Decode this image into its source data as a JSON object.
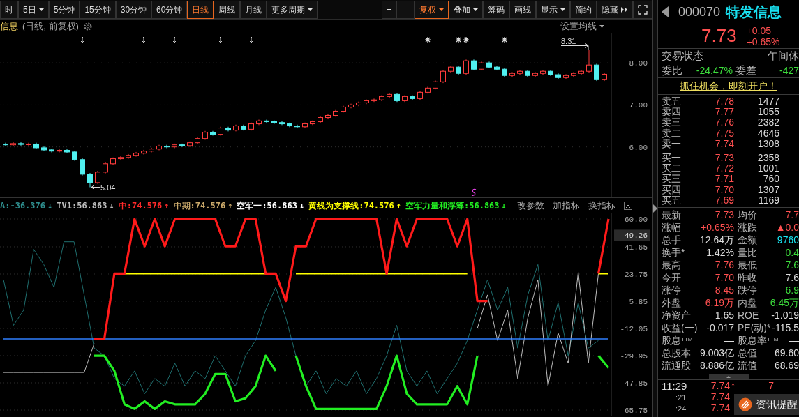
{
  "toolbar": {
    "periods": [
      {
        "label": "时",
        "selected": false,
        "dropdown": false
      },
      {
        "label": "5日",
        "selected": false,
        "dropdown": true
      },
      {
        "label": "5分钟",
        "selected": false,
        "dropdown": false
      },
      {
        "label": "15分钟",
        "selected": false,
        "dropdown": false
      },
      {
        "label": "30分钟",
        "selected": false,
        "dropdown": false
      },
      {
        "label": "60分钟",
        "selected": false,
        "dropdown": false
      },
      {
        "label": "日线",
        "selected": true,
        "dropdown": false
      },
      {
        "label": "周线",
        "selected": false,
        "dropdown": false
      },
      {
        "label": "月线",
        "selected": false,
        "dropdown": false
      },
      {
        "label": "更多周期",
        "selected": false,
        "dropdown": true
      }
    ],
    "tools": [
      {
        "label": "+",
        "selected": false,
        "dropdown": false
      },
      {
        "label": "—",
        "selected": false,
        "dropdown": false
      },
      {
        "label": "复权",
        "selected": true,
        "dropdown": true
      },
      {
        "label": "叠加",
        "selected": false,
        "dropdown": true
      },
      {
        "label": "筹码",
        "selected": false,
        "dropdown": false
      },
      {
        "label": "画线",
        "selected": false,
        "dropdown": false
      },
      {
        "label": "显示",
        "selected": false,
        "dropdown": true
      },
      {
        "label": "简约",
        "selected": false,
        "dropdown": false
      },
      {
        "label": "隐藏",
        "selected": false,
        "dropdown": false,
        "kind": "expand"
      }
    ]
  },
  "chart_header": {
    "title": "信息",
    "subtitle": "(日线, 前复权)",
    "ma_settings": "设置均线"
  },
  "price_chart": {
    "event_marks": [
      {
        "kind": "arrows"
      },
      {
        "kind": "arrows"
      },
      {
        "kind": "arrows"
      },
      {
        "kind": "arrows"
      },
      {
        "kind": "arrows"
      },
      {
        "kind": "star"
      },
      {
        "kind": "star"
      },
      {
        "kind": "star"
      },
      {
        "kind": "star"
      },
      {
        "kind": "signal"
      }
    ],
    "chart_data": {
      "type": "candlestick",
      "ylim": [
        4.8,
        8.7
      ],
      "grid": true,
      "yticks": [
        {
          "value": 8,
          "label": "8.00"
        },
        {
          "value": 7,
          "label": "7.00"
        },
        {
          "value": 6,
          "label": "6.00"
        }
      ],
      "ohlc": [
        [
          6.07,
          6.1,
          6.02,
          6.05
        ],
        [
          6.05,
          6.11,
          6.02,
          6.08
        ],
        [
          6.08,
          6.11,
          6.03,
          6.06
        ],
        [
          6.06,
          6.1,
          6.03,
          6.07
        ],
        [
          6.07,
          6.1,
          5.95,
          5.98
        ],
        [
          5.98,
          6.01,
          5.9,
          5.93
        ],
        [
          5.93,
          5.96,
          5.87,
          5.9
        ],
        [
          5.9,
          5.95,
          5.87,
          5.92
        ],
        [
          5.92,
          5.95,
          5.85,
          5.88
        ],
        [
          5.88,
          5.91,
          5.67,
          5.7
        ],
        [
          5.7,
          5.73,
          5.32,
          5.35
        ],
        [
          5.35,
          5.38,
          5.04,
          5.15
        ],
        [
          5.15,
          5.43,
          5.12,
          5.4
        ],
        [
          5.4,
          5.63,
          5.37,
          5.6
        ],
        [
          5.6,
          5.75,
          5.57,
          5.72
        ],
        [
          5.72,
          5.78,
          5.69,
          5.75
        ],
        [
          5.75,
          5.83,
          5.72,
          5.8
        ],
        [
          5.8,
          5.88,
          5.77,
          5.85
        ],
        [
          5.85,
          5.93,
          5.82,
          5.9
        ],
        [
          5.9,
          5.98,
          5.87,
          5.95
        ],
        [
          5.95,
          6.05,
          5.92,
          6.02
        ],
        [
          6.02,
          6.05,
          5.97,
          6.0
        ],
        [
          6.0,
          6.08,
          5.97,
          6.05
        ],
        [
          6.05,
          6.08,
          6.0,
          6.03
        ],
        [
          6.03,
          6.13,
          6.0,
          6.1
        ],
        [
          6.1,
          6.23,
          6.07,
          6.2
        ],
        [
          6.2,
          6.38,
          6.17,
          6.35
        ],
        [
          6.35,
          6.38,
          6.27,
          6.3
        ],
        [
          6.3,
          6.48,
          6.27,
          6.45
        ],
        [
          6.45,
          6.48,
          6.37,
          6.4
        ],
        [
          6.4,
          6.53,
          6.37,
          6.5
        ],
        [
          6.5,
          6.53,
          6.39,
          6.42
        ],
        [
          6.42,
          6.58,
          6.39,
          6.55
        ],
        [
          6.55,
          6.65,
          6.52,
          6.62
        ],
        [
          6.62,
          6.65,
          6.57,
          6.6
        ],
        [
          6.6,
          6.63,
          6.55,
          6.58
        ],
        [
          6.58,
          6.61,
          6.52,
          6.55
        ],
        [
          6.55,
          6.58,
          6.47,
          6.5
        ],
        [
          6.5,
          6.53,
          6.45,
          6.48
        ],
        [
          6.48,
          6.58,
          6.45,
          6.55
        ],
        [
          6.55,
          6.63,
          6.52,
          6.6
        ],
        [
          6.6,
          6.73,
          6.57,
          6.7
        ],
        [
          6.7,
          6.78,
          6.67,
          6.75
        ],
        [
          6.75,
          6.88,
          6.72,
          6.85
        ],
        [
          6.85,
          6.98,
          6.82,
          6.95
        ],
        [
          6.95,
          7.03,
          6.92,
          7.0
        ],
        [
          7.0,
          7.08,
          6.97,
          7.05
        ],
        [
          7.05,
          7.13,
          7.02,
          7.1
        ],
        [
          7.1,
          7.15,
          7.07,
          7.12
        ],
        [
          7.12,
          7.23,
          7.09,
          7.2
        ],
        [
          7.2,
          7.28,
          7.17,
          7.25
        ],
        [
          7.25,
          7.28,
          7.07,
          7.1
        ],
        [
          7.1,
          7.23,
          7.07,
          7.2
        ],
        [
          7.2,
          7.23,
          7.12,
          7.15
        ],
        [
          7.15,
          7.33,
          7.12,
          7.3
        ],
        [
          7.3,
          7.43,
          7.27,
          7.4
        ],
        [
          7.4,
          7.58,
          7.37,
          7.55
        ],
        [
          7.55,
          7.83,
          7.52,
          7.8
        ],
        [
          7.8,
          7.93,
          7.77,
          7.9
        ],
        [
          7.9,
          7.93,
          7.72,
          7.75
        ],
        [
          7.75,
          8.08,
          7.72,
          8.05
        ],
        [
          8.05,
          8.08,
          7.82,
          7.85
        ],
        [
          7.85,
          8.03,
          7.82,
          8.0
        ],
        [
          8.0,
          8.03,
          7.87,
          7.9
        ],
        [
          7.9,
          7.93,
          7.82,
          7.85
        ],
        [
          7.85,
          7.88,
          7.67,
          7.7
        ],
        [
          7.7,
          7.78,
          7.67,
          7.75
        ],
        [
          7.75,
          7.83,
          7.72,
          7.8
        ],
        [
          7.8,
          7.83,
          7.67,
          7.7
        ],
        [
          7.7,
          7.78,
          7.67,
          7.75
        ],
        [
          7.75,
          7.83,
          7.72,
          7.8
        ],
        [
          7.8,
          7.83,
          7.69,
          7.72
        ],
        [
          7.72,
          7.75,
          7.62,
          7.65
        ],
        [
          7.65,
          7.73,
          7.62,
          7.7
        ],
        [
          7.7,
          7.78,
          7.67,
          7.75
        ],
        [
          7.75,
          7.83,
          7.72,
          7.8
        ],
        [
          7.8,
          8.31,
          7.77,
          7.95
        ],
        [
          7.95,
          7.98,
          7.57,
          7.6
        ],
        [
          7.6,
          7.76,
          7.57,
          7.73
        ]
      ],
      "annotations": [
        "8.31",
        "5.04"
      ]
    }
  },
  "indicator": {
    "legend": [
      {
        "label": "A:-36.376",
        "arrow": "↓",
        "color": "#2f8f8f"
      },
      {
        "label": "TV1:56.863",
        "arrow": "↓",
        "color": "#bdbdbd"
      },
      {
        "label": "中:74.576",
        "arrow": "↑",
        "color": "#ff2a2a"
      },
      {
        "label": "中期:74.576",
        "arrow": "↑",
        "color": "#c9a86a"
      },
      {
        "label": "空军一:56.863",
        "arrow": "↓",
        "color": "#ffffff"
      },
      {
        "label": "黄线为支撑线:74.576",
        "arrow": "↑",
        "color": "#ffff00"
      },
      {
        "label": "空军力量和浮筹:56.863",
        "arrow": "↓",
        "color": "#22ee22"
      }
    ],
    "buttons": [
      "改参数",
      "加指标",
      "换指标"
    ],
    "current_label": "49.26",
    "chart_data": {
      "type": "line",
      "ylim": [
        -65.75,
        60
      ],
      "grid": true,
      "yticks": [
        {
          "value": 60,
          "label": "60.00"
        },
        {
          "value": 41.65,
          "label": "41.65"
        },
        {
          "value": 23.75,
          "label": "23.75"
        },
        {
          "value": 5.85,
          "label": "5.85"
        },
        {
          "value": -12.05,
          "label": "-12.05"
        },
        {
          "value": -29.95,
          "label": "-29.95"
        },
        {
          "value": -47.85,
          "label": "-47.85"
        },
        {
          "value": -65.75,
          "label": "-65.75"
        }
      ],
      "series": [
        {
          "color": "#1f6f6f",
          "values": [
            20,
            -10,
            0,
            40,
            30,
            15,
            45,
            45,
            10,
            -25,
            -30,
            -45,
            -50,
            -40,
            -55,
            -45,
            -50,
            -35,
            -50,
            -40,
            -45,
            -30,
            -40,
            -50,
            -30,
            -20,
            0,
            15,
            -5,
            -30,
            -50,
            -40,
            -55,
            -45,
            -50,
            -40,
            -55,
            -45,
            -30,
            -10,
            -40,
            -50,
            -40,
            -55,
            -45,
            -35,
            -20,
            0,
            20,
            0,
            15,
            -25,
            10,
            30,
            -20,
            5,
            -30,
            5,
            -25,
            -20,
            null
          ]
        },
        {
          "color": "#bdbdbd",
          "values": [
            -41,
            -41,
            -41,
            -41,
            -41,
            -41,
            -41,
            -41,
            -41,
            -22,
            null,
            null,
            null,
            null,
            null,
            null,
            null,
            null,
            null,
            null,
            null,
            null,
            null,
            null,
            null,
            null,
            null,
            null,
            null,
            null,
            null,
            null,
            null,
            null,
            null,
            null,
            null,
            null,
            null,
            null,
            null,
            null,
            null,
            null,
            null,
            null,
            null,
            -12,
            10,
            -20,
            0,
            -45,
            -5,
            20,
            -50,
            -15,
            -35,
            25,
            -35,
            24,
            null
          ]
        },
        {
          "color": "#2f7fff",
          "values": [
            -19,
            -19,
            -19,
            -19,
            -19,
            -19,
            -19,
            -19,
            -19,
            -19,
            -19,
            -19,
            -19,
            -19,
            -19,
            -19,
            -19,
            -19,
            -19,
            -19,
            -19,
            -19,
            -19,
            -19,
            -19,
            -19,
            -19,
            -19,
            -19,
            -19,
            -19,
            -19,
            -19,
            -19,
            -19,
            -19,
            -19,
            -19,
            -19,
            -19,
            -19,
            -19,
            -19,
            -19,
            -19,
            -19,
            -19,
            -19,
            -19,
            -19,
            -19,
            -19,
            -19,
            -19,
            -19,
            -19,
            -19,
            -19,
            -19,
            -19,
            -19
          ]
        },
        {
          "color": "#ffff00",
          "values": [
            null,
            null,
            null,
            null,
            null,
            null,
            null,
            null,
            null,
            null,
            null,
            null,
            24,
            24,
            24,
            24,
            24,
            24,
            24,
            24,
            24,
            24,
            24,
            24,
            24,
            24,
            24,
            null,
            null,
            24,
            24,
            24,
            24,
            24,
            24,
            24,
            24,
            24,
            24,
            24,
            24,
            24,
            24,
            24,
            24,
            24,
            24,
            null,
            null,
            null,
            null,
            null,
            null,
            null,
            null,
            null,
            null,
            null,
            null,
            24,
            24
          ]
        },
        {
          "color": "#ff1a1a",
          "values": [
            null,
            null,
            null,
            null,
            null,
            null,
            null,
            null,
            null,
            -19,
            -19,
            24,
            24,
            60,
            42,
            60,
            42,
            60,
            60,
            60,
            60,
            60,
            42,
            42,
            60,
            60,
            24,
            24,
            6,
            42,
            42,
            60,
            60,
            60,
            60,
            60,
            60,
            60,
            24,
            60,
            42,
            60,
            60,
            60,
            60,
            42,
            60,
            6,
            6,
            null,
            null,
            null,
            null,
            null,
            null,
            null,
            null,
            null,
            null,
            24,
            60
          ]
        },
        {
          "color": "#22ee22",
          "values": [
            null,
            null,
            null,
            null,
            null,
            null,
            null,
            null,
            null,
            -30,
            -30,
            -40,
            -62,
            -65,
            -60,
            -65,
            -60,
            -62,
            -62,
            -62,
            -55,
            -42,
            -42,
            -60,
            -58,
            -50,
            -30,
            -40,
            null,
            -30,
            -50,
            -65,
            -65,
            -65,
            -65,
            -65,
            -65,
            -65,
            -50,
            -30,
            -55,
            -62,
            -62,
            -62,
            -62,
            -50,
            -62,
            -30,
            null,
            null,
            null,
            null,
            null,
            null,
            null,
            null,
            null,
            null,
            null,
            -30,
            -38
          ]
        }
      ]
    }
  },
  "quote": {
    "code": "000070",
    "name": "特发信息",
    "price": "7.73",
    "change": "+0.05",
    "change_pct": "+0.65%"
  },
  "trade_status": {
    "label": "交易状态",
    "value": "午间休"
  },
  "order_ratio": [
    {
      "label": "委比",
      "value": "-24.47%"
    },
    {
      "label": "委差",
      "value": "-427"
    }
  ],
  "promo_link": "抓住机会，即刻开户！",
  "asks": [
    {
      "label": "卖五",
      "price": "7.78",
      "volume": "1477"
    },
    {
      "label": "卖四",
      "price": "7.77",
      "volume": "1055"
    },
    {
      "label": "卖三",
      "price": "7.76",
      "volume": "2382"
    },
    {
      "label": "卖二",
      "price": "7.75",
      "volume": "4646"
    },
    {
      "label": "卖一",
      "price": "7.74",
      "volume": "1308"
    }
  ],
  "bids": [
    {
      "label": "买一",
      "price": "7.73",
      "volume": "2358"
    },
    {
      "label": "买二",
      "price": "7.72",
      "volume": "1001"
    },
    {
      "label": "买三",
      "price": "7.71",
      "volume": "760"
    },
    {
      "label": "买四",
      "price": "7.70",
      "volume": "1307"
    },
    {
      "label": "买五",
      "price": "7.69",
      "volume": "1169"
    }
  ],
  "stats": [
    {
      "items": [
        {
          "label": "最新",
          "value": "7.73",
          "color": "#ff5050"
        },
        {
          "label": "均价",
          "value": "7.7",
          "color": "#ff5050"
        }
      ]
    },
    {
      "items": [
        {
          "label": "涨幅",
          "value": "+0.65%",
          "color": "#ff5050"
        },
        {
          "label": "涨跌",
          "value": "▲0.0",
          "color": "#ff5050"
        }
      ]
    },
    {
      "items": [
        {
          "label": "总手",
          "value": "12.64万",
          "color": "#dddddd"
        },
        {
          "label": "金额",
          "value": "9760",
          "color": "#19e8f5"
        }
      ]
    },
    {
      "items": [
        {
          "label": "换手*",
          "value": "1.42%",
          "color": "#dddddd"
        },
        {
          "label": "量比",
          "value": "0.4",
          "color": "#3cdc3c"
        }
      ]
    },
    {
      "items": [
        {
          "label": "最高",
          "value": "7.76",
          "color": "#ff5050"
        },
        {
          "label": "最低",
          "value": "7.6",
          "color": "#3cdc3c"
        }
      ]
    },
    {
      "items": [
        {
          "label": "今开",
          "value": "7.70",
          "color": "#ff5050"
        },
        {
          "label": "昨收",
          "value": "7.6",
          "color": "#dddddd"
        }
      ]
    },
    {
      "items": [
        {
          "label": "涨停",
          "value": "8.45",
          "color": "#ff5050"
        },
        {
          "label": "跌停",
          "value": "6.9",
          "color": "#3cdc3c"
        }
      ]
    },
    {
      "items": [
        {
          "label": "外盘",
          "value": "6.19万",
          "color": "#ff5050"
        },
        {
          "label": "内盘",
          "value": "6.45万",
          "color": "#3cdc3c"
        }
      ]
    },
    {
      "items": [
        {
          "label": "净资产",
          "value": "1.65",
          "color": "#dddddd"
        },
        {
          "label": "ROE",
          "value": "-1.019",
          "color": "#dddddd"
        }
      ]
    },
    {
      "items": [
        {
          "label": "收益(一)",
          "value": "-0.017",
          "color": "#dddddd"
        },
        {
          "label": "PE(动)*",
          "value": "-115.5",
          "color": "#dddddd"
        }
      ]
    },
    {
      "items": [
        {
          "label": "股息$^{TTM}$",
          "value": "—",
          "color": "#dddddd"
        },
        {
          "label": "股息率$^{TTM}$",
          "value": "—",
          "color": "#dddddd"
        }
      ]
    },
    {
      "items": [
        {
          "label": "总股本",
          "value": "9.003亿",
          "color": "#dddddd"
        },
        {
          "label": "总值",
          "value": "69.60",
          "color": "#dddddd"
        }
      ]
    },
    {
      "items": [
        {
          "label": "流通股",
          "value": "8.886亿",
          "color": "#dddddd"
        },
        {
          "label": "流值",
          "value": "68.69",
          "color": "#dddddd"
        }
      ]
    }
  ],
  "ticks": [
    {
      "time": "11:29",
      "price": "7.74",
      "arrow": "↑",
      "volume": "7"
    },
    {
      "time": ":21",
      "price": "7.74"
    },
    {
      "time": ":24",
      "price": "7.74"
    }
  ],
  "news_popup": {
    "label": "资讯提醒"
  }
}
